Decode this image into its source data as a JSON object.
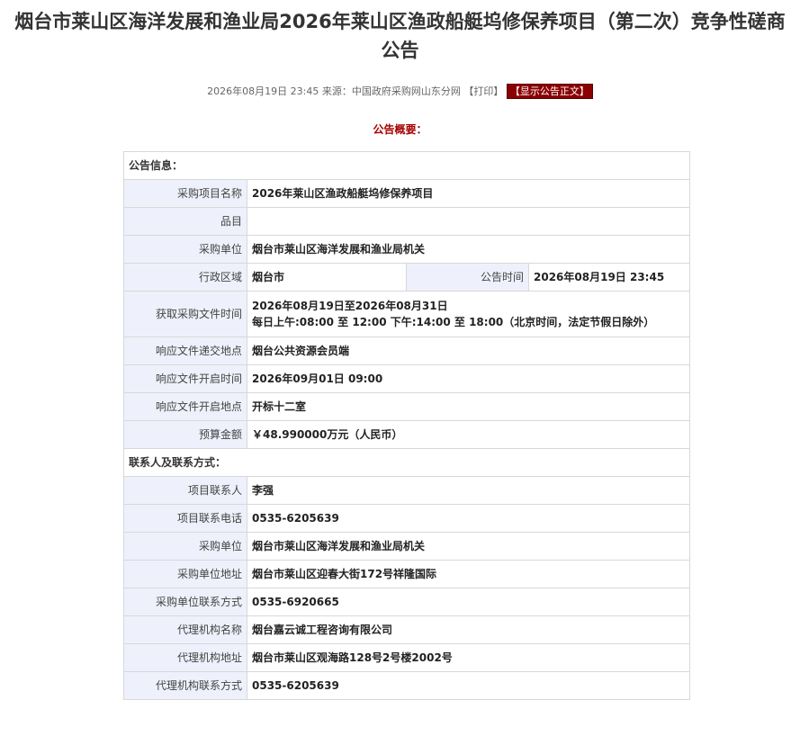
{
  "header": {
    "title": "烟台市莱山区海洋发展和渔业局2026年莱山区渔政船艇坞修保养项目（第二次）竞争性磋商公告",
    "date": "2026年08月19日 23:45",
    "source_label": "来源：",
    "source": "中国政府采购网山东分网",
    "print_label": "【打印】",
    "show_label": "【显示公告正文】"
  },
  "overview_label": "公告概要：",
  "info": {
    "section1": "公告信息：",
    "project_name_label": "采购项目名称",
    "project_name": "2026年莱山区渔政船艇坞修保养项目",
    "item_label": "品目",
    "item": "",
    "buyer_label": "采购单位",
    "buyer": "烟台市莱山区海洋发展和渔业局机关",
    "region_label": "行政区域",
    "region": "烟台市",
    "pub_time_label": "公告时间",
    "pub_time": "2026年08月19日 23:45",
    "doc_time_label": "获取采购文件时间",
    "doc_time_line1": "2026年08月19日至2026年08月31日",
    "doc_time_line2": "每日上午:08:00 至 12:00  下午:14:00 至 18:00（北京时间，法定节假日除外）",
    "submit_place_label": "响应文件递交地点",
    "submit_place": "烟台公共资源会员端",
    "open_time_label": "响应文件开启时间",
    "open_time": "2026年09月01日 09:00",
    "open_place_label": "响应文件开启地点",
    "open_place": "开标十二室",
    "budget_label": "预算金额",
    "budget": "￥48.990000万元（人民币）",
    "section2": "联系人及联系方式：",
    "contact_label": "项目联系人",
    "contact": "李强",
    "contact_phone_label": "项目联系电话",
    "contact_phone": "0535-6205639",
    "buyer2_label": "采购单位",
    "buyer2": "烟台市莱山区海洋发展和渔业局机关",
    "buyer_addr_label": "采购单位地址",
    "buyer_addr": "烟台市莱山区迎春大街172号祥隆国际",
    "buyer_phone_label": "采购单位联系方式",
    "buyer_phone": "0535-6920665",
    "agent_label": "代理机构名称",
    "agent": "烟台嘉云诚工程咨询有限公司",
    "agent_addr_label": "代理机构地址",
    "agent_addr": "烟台市莱山区观海路128号2号楼2002号",
    "agent_phone_label": "代理机构联系方式",
    "agent_phone": "0535-6205639"
  }
}
